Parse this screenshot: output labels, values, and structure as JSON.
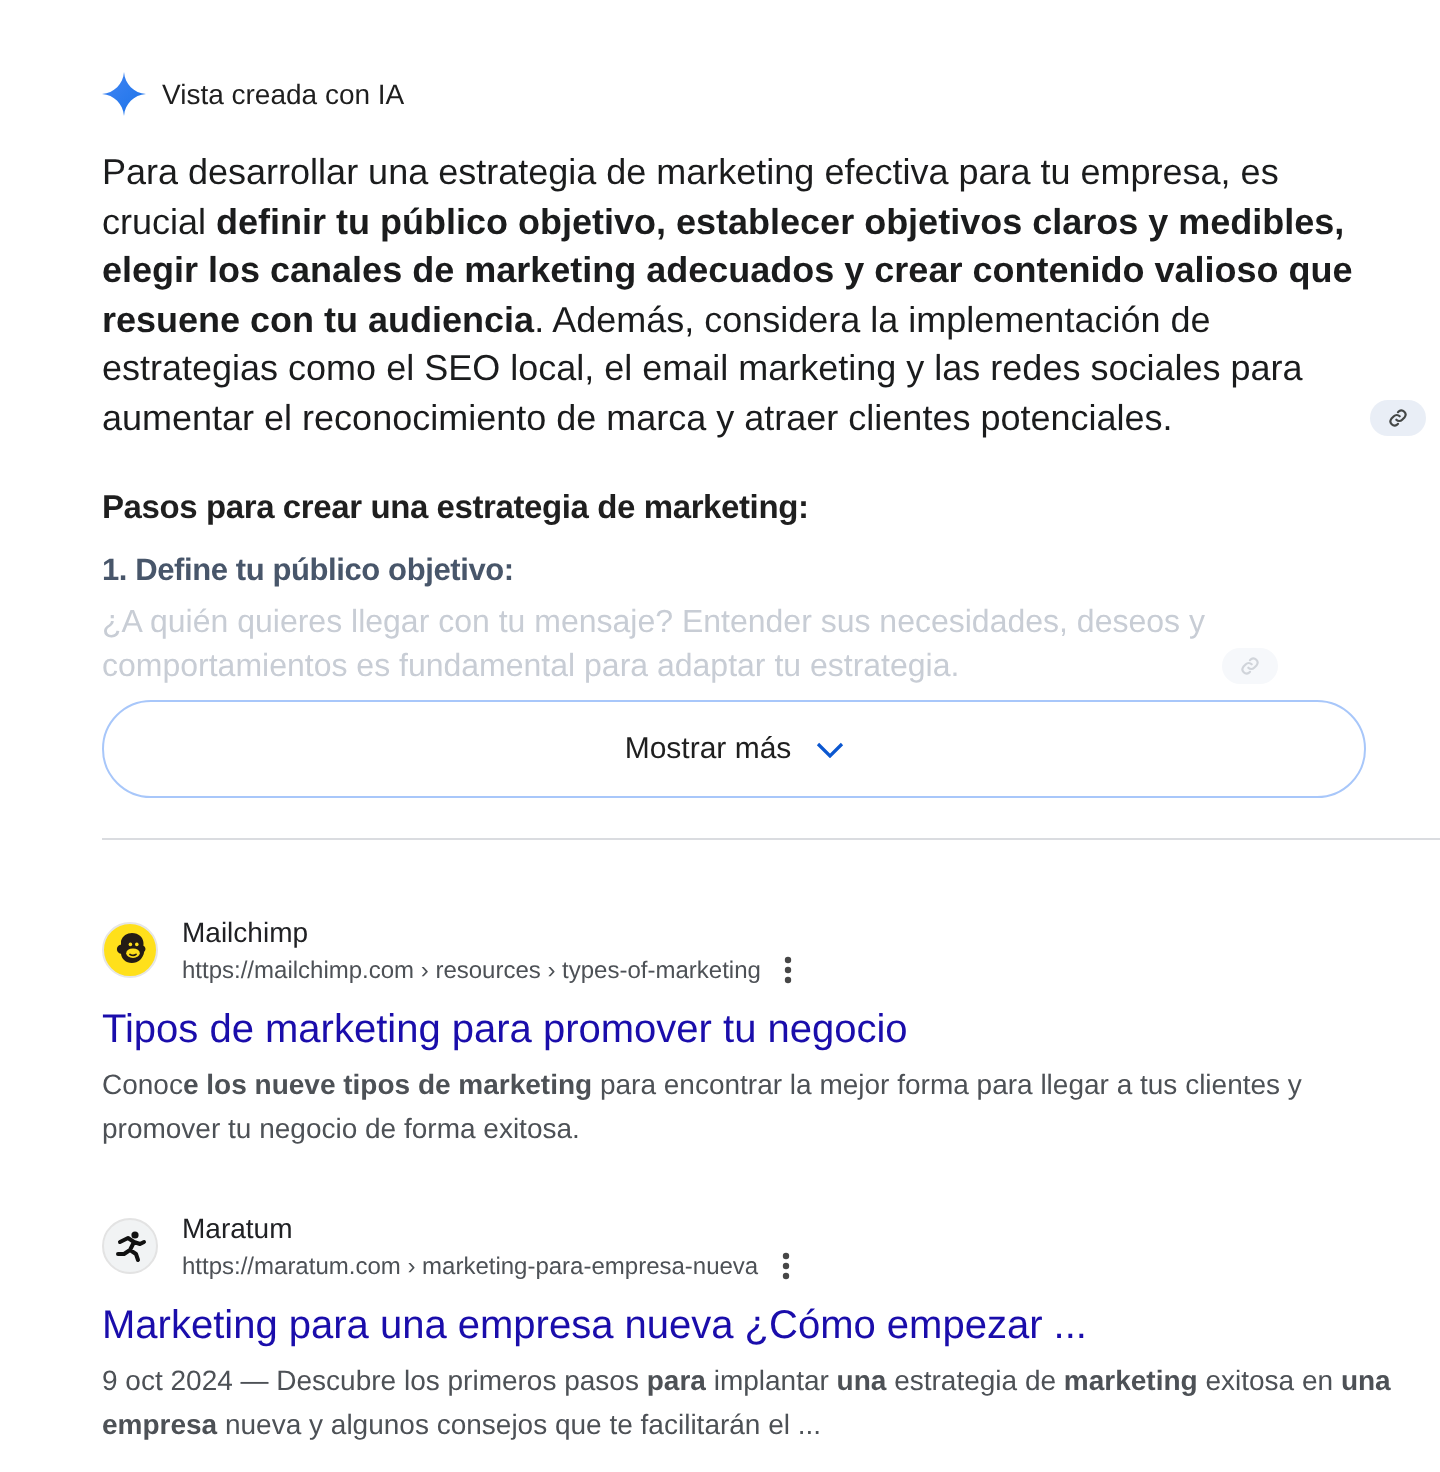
{
  "ai_overview": {
    "label": "Vista creada con IA",
    "summary": "Para desarrollar una estrategia de marketing efectiva para tu empresa, es crucial **definir tu público objetivo, establecer objetivos claros y medibles, elegir los canales de marketing adecuados y crear contenido valioso que resuene con tu audiencia**. Además, considera la implementación de estrategias como el SEO local, el email marketing y las redes sociales para aumentar el reconocimiento de marca y atraer clientes potenciales.",
    "steps_heading": "Pasos para crear una estrategia de marketing:",
    "steps": [
      {
        "title": "1. Define tu público objetivo:",
        "text": "¿A quién quieres llegar con tu mensaje? Entender sus necesidades, deseos y comportamientos es fundamental para adaptar tu estrategia."
      }
    ],
    "show_more": "Mostrar más"
  },
  "results": [
    {
      "kind": "head",
      "site": "Mailchimp",
      "url": "https://mailchimp.com › resources › types-of-marketing",
      "title": "Tipos de marketing para promover tu negocio",
      "snippet": "Conoc**e los nueve tipos de marketing** para encontrar la mejor forma para llegar a tus clientes y promover tu negocio de forma exitosa."
    },
    {
      "kind": "runner",
      "site": "Maratum",
      "url": "https://maratum.com › marketing-para-empresa-nueva",
      "title": "Marketing para una empresa nueva ¿Cómo empezar ...",
      "snippet": "9 oct 2024 — Descubre los primeros pasos **para** implantar **una** estrategia de **marketing** exitosa en **una empresa** nueva y algunos consejos que te facilitarán el ..."
    }
  ]
}
